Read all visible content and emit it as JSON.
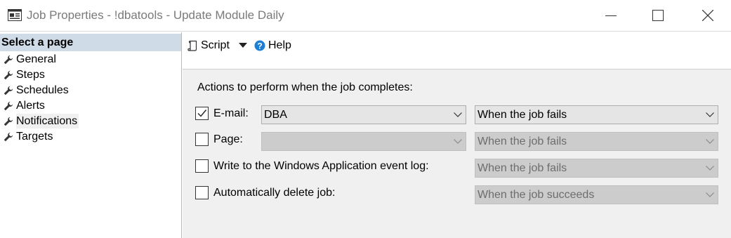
{
  "window": {
    "title": "Job Properties - !dbatools - Update Module Daily",
    "icon": "window-app-icon",
    "controls": [
      "minimize-icon",
      "maximize-icon",
      "close-icon"
    ]
  },
  "sidebar": {
    "header": "Select a page",
    "items": [
      {
        "label": "General",
        "icon": "wrench-icon"
      },
      {
        "label": "Steps",
        "icon": "wrench-icon"
      },
      {
        "label": "Schedules",
        "icon": "wrench-icon"
      },
      {
        "label": "Alerts",
        "icon": "wrench-icon"
      },
      {
        "label": "Notifications",
        "icon": "wrench-icon",
        "selected": true
      },
      {
        "label": "Targets",
        "icon": "wrench-icon"
      }
    ]
  },
  "toolbar": {
    "script_label": "Script",
    "help_label": "Help"
  },
  "notifications": {
    "section_label": "Actions to perform when the job completes:",
    "rows": [
      {
        "label": "E-mail:",
        "checked": true,
        "target": "DBA",
        "target_enabled": true,
        "condition": "When the job fails",
        "condition_enabled": true
      },
      {
        "label": "Page:",
        "checked": false,
        "target": "",
        "target_enabled": false,
        "condition": "When the job fails",
        "condition_enabled": false
      },
      {
        "label": "Write to the Windows Application event log:",
        "checked": false,
        "condition": "When the job fails",
        "condition_enabled": false
      },
      {
        "label": "Automatically delete job:",
        "checked": false,
        "condition": "When the job succeeds",
        "condition_enabled": false
      }
    ]
  },
  "colors": {
    "sidebar_header_bg": "#cfdbe7",
    "content_bg": "#f0f0f0",
    "help_icon": "#1c7fd6",
    "disabled_combo_bg": "#cccccc",
    "enabled_combo_bg": "#e5e5e5"
  }
}
